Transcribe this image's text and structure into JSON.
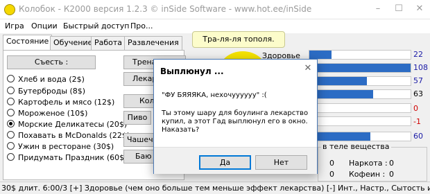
{
  "window": {
    "title": "Колобок - К2000  версия 1.2.3  © inSide Software - www.hot.ee/inSide",
    "minimize": "–",
    "maximize": "☐",
    "close": "✕"
  },
  "menu": [
    "Игра",
    "Опции",
    "Быстрый доступ",
    "Про..."
  ],
  "tabs": [
    "Состояние",
    "Обучение",
    "Работа",
    "Развлечения"
  ],
  "eat_button": "Съесть :",
  "food_options": [
    "Хлеб и вода (2$)",
    "Бутерброды (8$)",
    "Картофель и мясо (12$)",
    "Мороженое (10$)",
    "Морские Деликатесы (20$)",
    "Похавать в McDonalds (22$)",
    "Ужин в ресторане (30$)",
    "Придумать Праздник (60$)"
  ],
  "selected_food_index": 4,
  "side_buttons": [
    "Трена",
    "Лекар",
    "Кол",
    "Пиво",
    "",
    "Чашечк",
    "Баю -"
  ],
  "speech": "Тра-ля-ля тополя.",
  "stats": [
    {
      "label": "Здоровье",
      "value": "22",
      "fill": 0.22,
      "color": "#1a1aa6"
    },
    {
      "label": "",
      "value": "108",
      "fill": 1.0,
      "color": "#1a1aa6"
    },
    {
      "label": "",
      "value": "57",
      "fill": 0.57,
      "color": "#1a1aa6"
    },
    {
      "label": "",
      "value": "63",
      "fill": 0.63,
      "color": "#000000"
    },
    {
      "label": "",
      "value": "0",
      "fill": 0,
      "color": "#d00000"
    },
    {
      "label": "",
      "value": "-1",
      "fill": 0,
      "color": "#d00000"
    },
    {
      "label": "",
      "value": "60",
      "fill": 0.6,
      "color": "#1a1aa6"
    }
  ],
  "body_substances": {
    "title": "в теле вещества",
    "rows": [
      {
        "label": "Наркота :",
        "value": "0",
        "left_value": "0"
      },
      {
        "label": "Кофеин :",
        "value": "0",
        "left_value": "0"
      }
    ]
  },
  "status_bar": "30$ длит. 6:00/3  [+] Здоровье (чем оно больше тем меньше эффект лекарства) [-] Инт., Настр., Сытость и Посл.",
  "dialog": {
    "title": "Выплюнул ...",
    "close": "✕",
    "line1": "\"ФУ БЯЯЯКА, нехочуууууу\" :(",
    "message": "Ты этому шару для боулинга лекарство купил, а этот Гад выплюнул его в окно. Наказать?",
    "yes": "Да",
    "no": "Нет"
  }
}
